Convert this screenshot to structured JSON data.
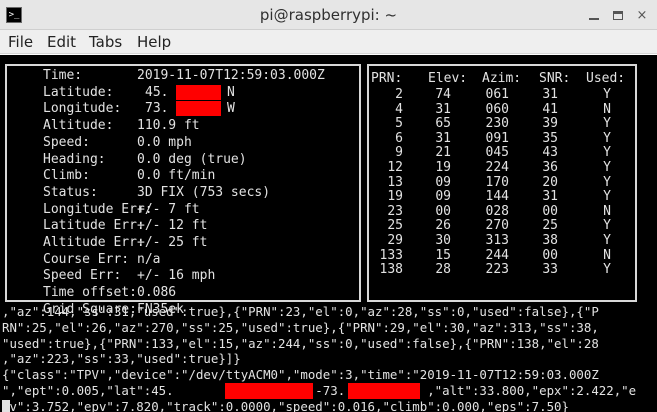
{
  "window": {
    "title": "pi@raspberrypi: ~",
    "icons": {
      "app": "terminal-icon",
      "minimize": "minimize-icon",
      "maximize": "maximize-icon",
      "close": "close-icon"
    },
    "close_glyph": "×",
    "app_glyph": ">_"
  },
  "menu": [
    "File",
    "Edit",
    "Tabs",
    "Help"
  ],
  "gps": {
    "fields": [
      {
        "label": "Time:",
        "value": "2019-11-07T12:59:03.000Z"
      },
      {
        "label": "Latitude:",
        "value": "45.",
        "suffix": "N"
      },
      {
        "label": "Longitude:",
        "value": "73.",
        "suffix": "W"
      },
      {
        "label": "Altitude:",
        "value": "110.9 ft"
      },
      {
        "label": "Speed:",
        "value": "0.0 mph"
      },
      {
        "label": "Heading:",
        "value": "0.0 deg (true)"
      },
      {
        "label": "Climb:",
        "value": "0.0 ft/min"
      },
      {
        "label": "Status:",
        "value": "3D FIX (753 secs)"
      },
      {
        "label": "Longitude Err:",
        "value": "+/- 7 ft"
      },
      {
        "label": "Latitude Err:",
        "value": "+/- 12 ft"
      },
      {
        "label": "Altitude Err:",
        "value": "+/- 25 ft"
      },
      {
        "label": "Course Err:",
        "value": "n/a"
      },
      {
        "label": "Speed Err:",
        "value": "+/- 16 mph"
      },
      {
        "label": "Time offset:",
        "value": "0.086"
      },
      {
        "label": "Grid Square:",
        "value": "FN35ek"
      }
    ]
  },
  "satellites": {
    "headers": [
      "PRN:",
      "Elev:",
      "Azim:",
      "SNR:",
      "Used:"
    ],
    "rows": [
      [
        "2",
        "74",
        "061",
        "31",
        "Y"
      ],
      [
        "4",
        "31",
        "060",
        "41",
        "N"
      ],
      [
        "5",
        "65",
        "230",
        "39",
        "Y"
      ],
      [
        "6",
        "31",
        "091",
        "35",
        "Y"
      ],
      [
        "9",
        "21",
        "045",
        "43",
        "Y"
      ],
      [
        "12",
        "19",
        "224",
        "36",
        "Y"
      ],
      [
        "13",
        "09",
        "170",
        "20",
        "Y"
      ],
      [
        "19",
        "09",
        "144",
        "31",
        "Y"
      ],
      [
        "23",
        "00",
        "028",
        "00",
        "N"
      ],
      [
        "25",
        "26",
        "270",
        "25",
        "Y"
      ],
      [
        "29",
        "30",
        "313",
        "38",
        "Y"
      ],
      [
        "133",
        "15",
        "244",
        "00",
        "N"
      ],
      [
        "138",
        "28",
        "223",
        "33",
        "Y"
      ]
    ]
  },
  "json_output": [
    ",\"az\":144,\"ss\":31,\"used\":true},{\"PRN\":23,\"el\":0,\"az\":28,\"ss\":0,\"used\":false},{\"P",
    "RN\":25,\"el\":26,\"az\":270,\"ss\":25,\"used\":true},{\"PRN\":29,\"el\":30,\"az\":313,\"ss\":38,",
    "\"used\":true},{\"PRN\":133,\"el\":15,\"az\":244,\"ss\":0,\"used\":false},{\"PRN\":138,\"el\":28",
    ",\"az\":223,\"ss\":33,\"used\":true}]}",
    "{\"class\":\"TPV\",\"device\":\"/dev/ttyACM0\",\"mode\":3,\"time\":\"2019-11-07T12:59:03.000Z",
    "\",\"ept\":0.005,\"lat\":45.            ,\"lon\":-73.           ,\"alt\":33.800,\"epx\":2.422,\"e",
    "pv\":3.752,\"epv\":7.820,\"track\":0.0000,\"speed\":0.016,\"climb\":0.000,\"eps\":7.50}"
  ],
  "colors": {
    "terminal_bg": "#000000",
    "terminal_fg": "#e2e2e2",
    "redaction": "#ff0000",
    "titlebar_bg": "#e6e6e6",
    "menubar_bg": "#efefef"
  }
}
